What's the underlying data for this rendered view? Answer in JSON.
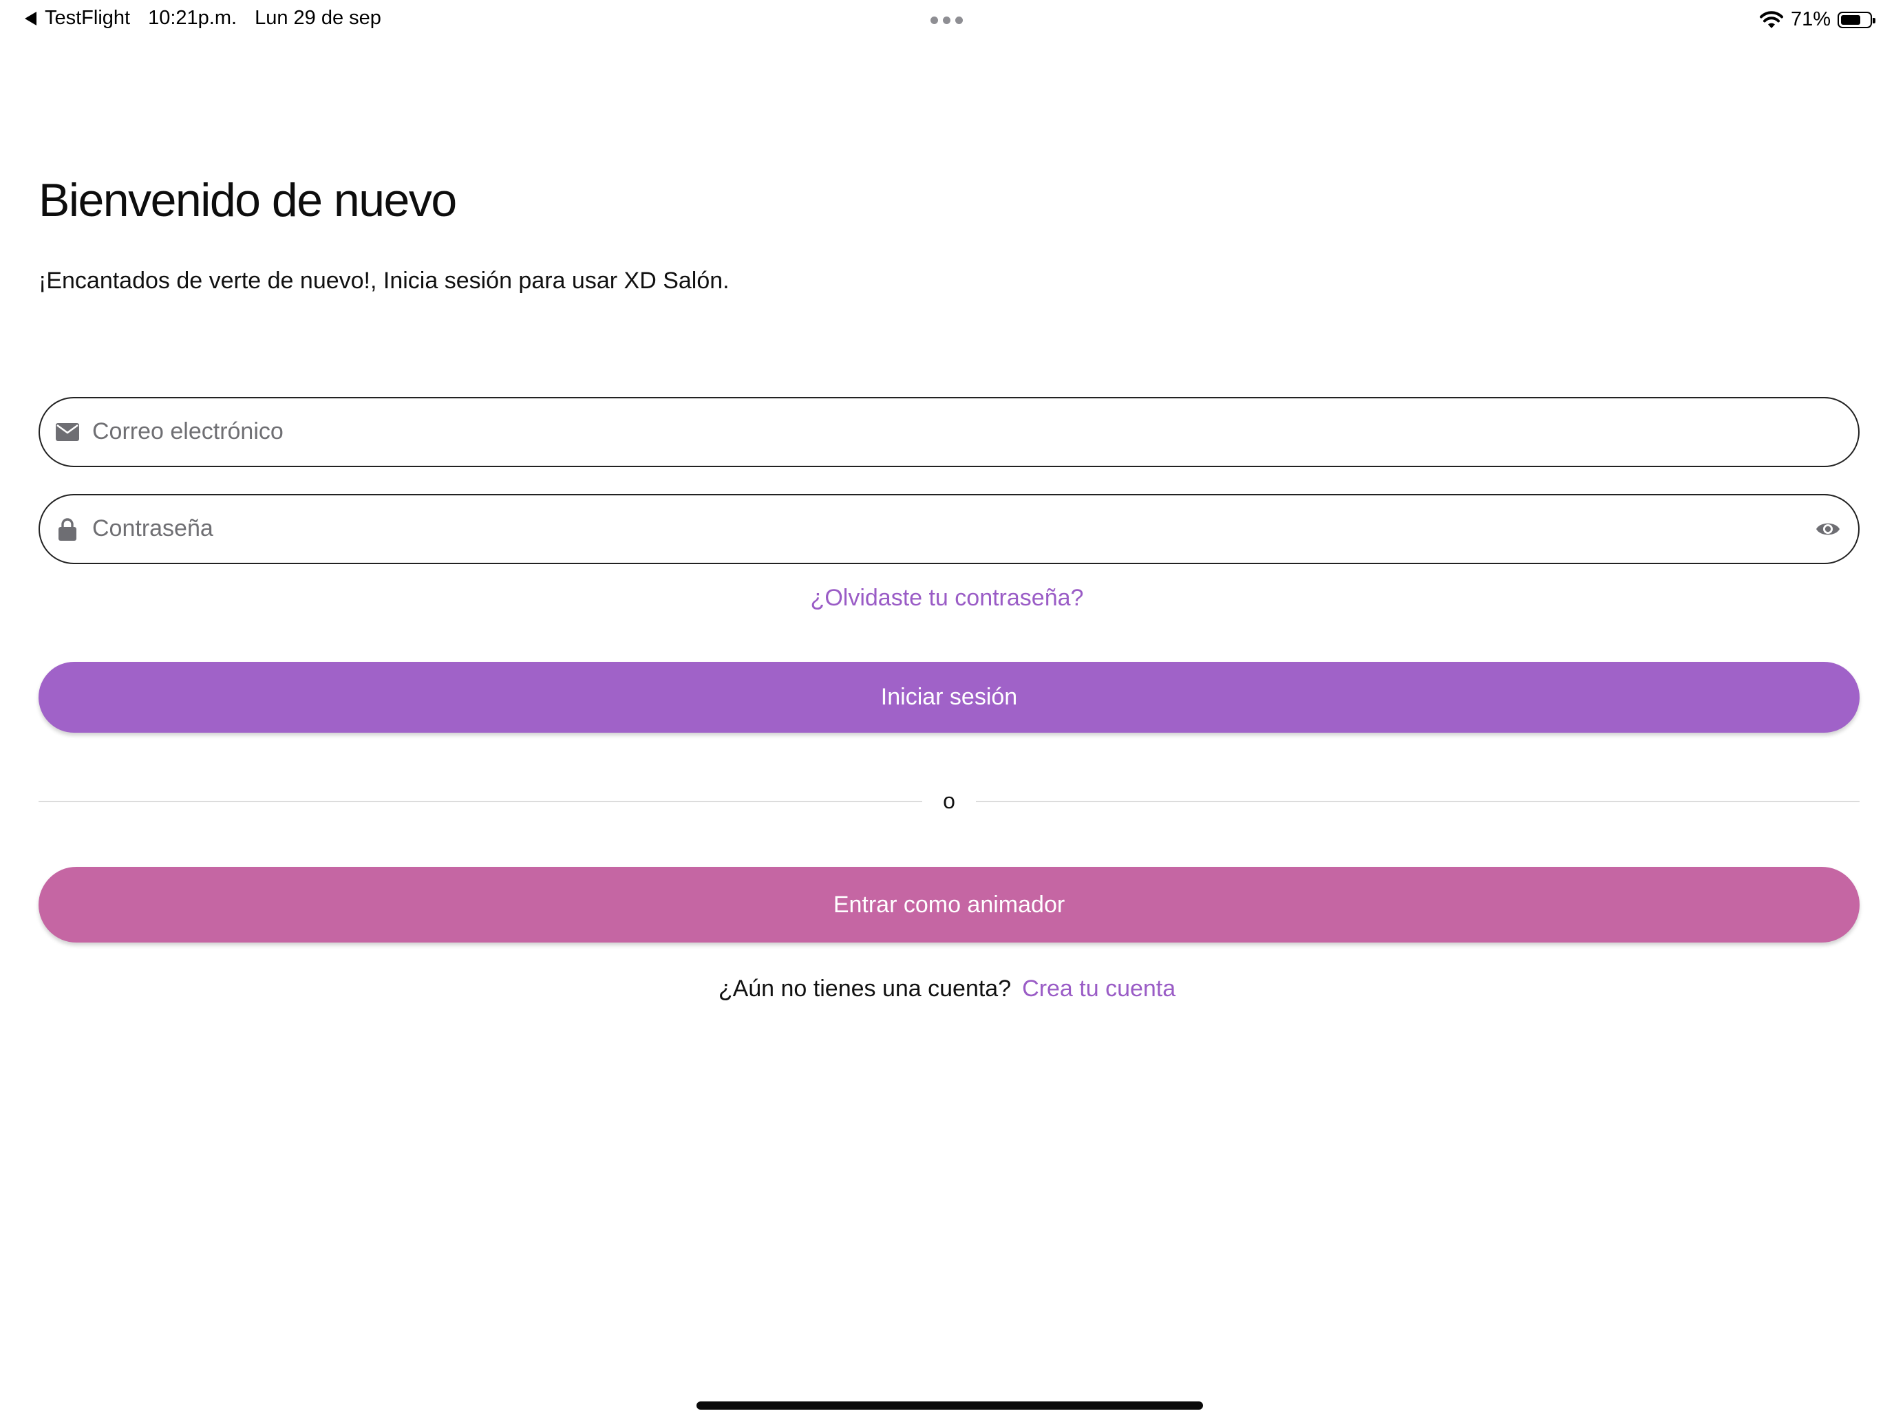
{
  "status_bar": {
    "back_app": "TestFlight",
    "time": "10:21p.m.",
    "date": "Lun 29 de sep",
    "battery_percent": "71%",
    "battery_level": 0.71
  },
  "header": {
    "title": "Bienvenido de nuevo",
    "subtitle": "¡Encantados de verte de nuevo!, Inicia sesión para usar XD Salón."
  },
  "form": {
    "email": {
      "placeholder": "Correo electrónico",
      "value": "",
      "icon": "envelope-icon"
    },
    "password": {
      "placeholder": "Contraseña",
      "value": "",
      "icon": "lock-icon",
      "toggle_icon": "eye-icon"
    },
    "forgot_password": "¿Olvidaste tu contraseña?",
    "login_button": "Iniciar sesión",
    "divider_text": "o",
    "host_button": "Entrar como animador",
    "signup_prompt": "¿Aún no tienes una cuenta?",
    "signup_link": "Crea tu cuenta"
  },
  "colors": {
    "primary_purple": "#a062c8",
    "host_pink": "#c566a3",
    "link_purple": "#9a5cc6",
    "field_border": "#222222",
    "icon_gray": "#6e6e73"
  }
}
